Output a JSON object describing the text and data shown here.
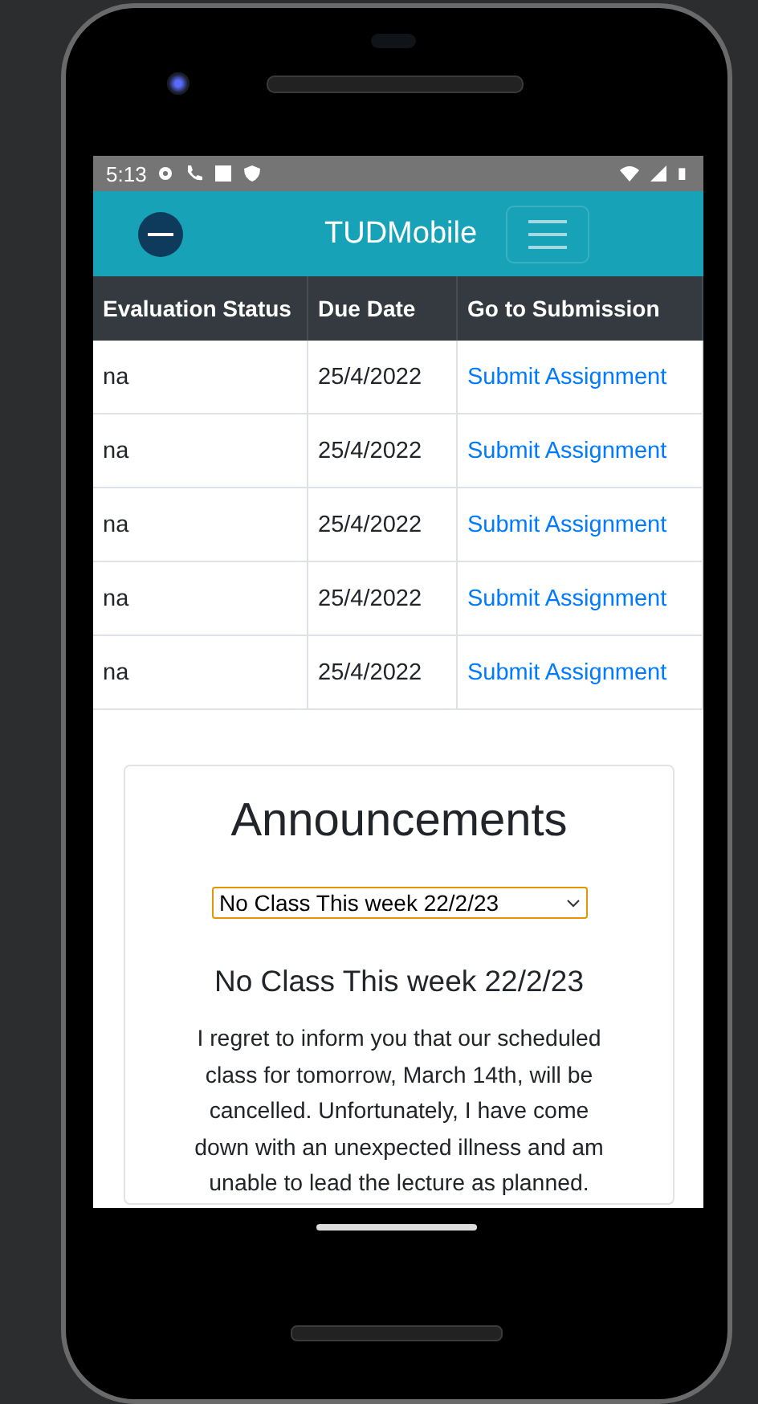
{
  "status_bar": {
    "time": "5:13"
  },
  "header": {
    "title": "TUDMobile"
  },
  "table": {
    "columns": [
      "Evaluation Status",
      "Due Date",
      "Go to Submission"
    ],
    "rows": [
      {
        "status": "na",
        "due": "25/4/2022",
        "link": "Submit Assignment"
      },
      {
        "status": "na",
        "due": "25/4/2022",
        "link": "Submit Assignment"
      },
      {
        "status": "na",
        "due": "25/4/2022",
        "link": "Submit Assignment"
      },
      {
        "status": "na",
        "due": "25/4/2022",
        "link": "Submit Assignment"
      },
      {
        "status": "na",
        "due": "25/4/2022",
        "link": "Submit Assignment"
      }
    ]
  },
  "announcements": {
    "title": "Announcements",
    "select": {
      "value": "No Class This week 22/2/23",
      "focused": true
    },
    "heading": "No Class This week 22/2/23",
    "body": "I regret to inform you that our scheduled class for tomorrow, March 14th, will be cancelled. Unfortunately, I have come down with an unexpected illness and am unable to lead the lecture as planned."
  }
}
